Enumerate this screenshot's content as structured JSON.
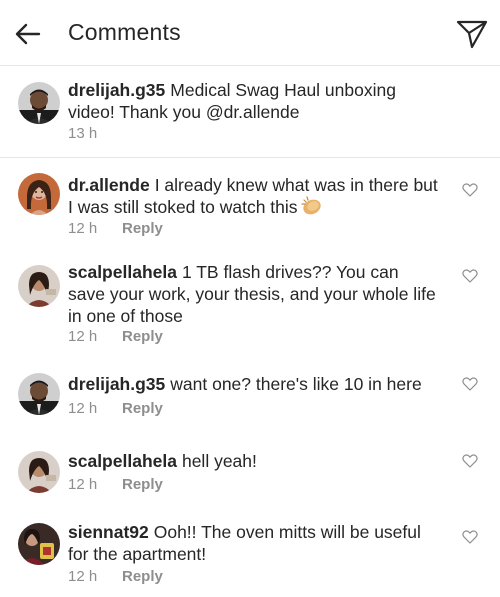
{
  "header": {
    "title": "Comments",
    "back_icon": "arrow-left-icon",
    "send_icon": "paper-plane-icon"
  },
  "caption": {
    "username": "drelijah.g35",
    "text": "Medical Swag Haul unboxing video! Thank you @dr.allende",
    "time": "13 h"
  },
  "comments": [
    {
      "username": "dr.allende",
      "text": "I already knew what was in there but I was still stoked to watch this",
      "emoji_icon": "clapping-hands-icon",
      "time": "12 h",
      "reply": "Reply"
    },
    {
      "username": "scalpellahela",
      "text": "1 TB flash drives?? You can save your work, your thesis, and your whole life in one of those",
      "time": "12 h",
      "reply": "Reply"
    },
    {
      "username": "drelijah.g35",
      "text": "want one? there's like 10 in here",
      "time": "12 h",
      "reply": "Reply"
    },
    {
      "username": "scalpellahela",
      "text": "hell yeah!",
      "time": "12 h",
      "reply": "Reply"
    },
    {
      "username": "siennat92",
      "text": "Ooh!! The oven mitts will be useful for the apartment!",
      "time": "12 h",
      "reply": "Reply"
    }
  ],
  "colors": {
    "text": "#262626",
    "secondary": "#8e8e8e",
    "divider": "#e6e6e6",
    "background": "#ffffff"
  }
}
